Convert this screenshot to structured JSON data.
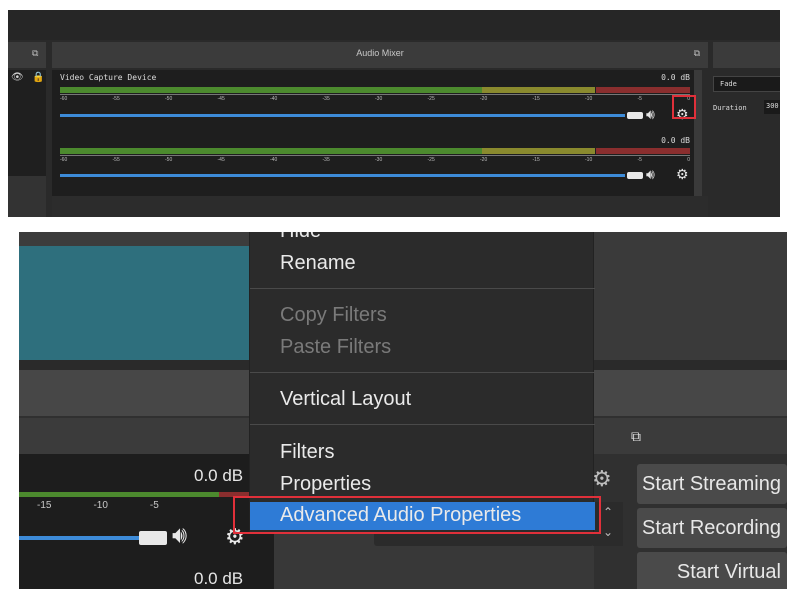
{
  "top_panel": {
    "mixer_title": "Audio Mixer",
    "source_name": "Video Capture Device",
    "db_level_1": "0.0 dB",
    "db_level_2": "0.0 dB",
    "ticks": [
      "-60",
      "-55",
      "-50",
      "-45",
      "-40",
      "-35",
      "-30",
      "-25",
      "-20",
      "-15",
      "-10",
      "-5",
      "0"
    ],
    "transition": {
      "type": "Fade",
      "duration_label": "Duration",
      "duration_value": "300"
    }
  },
  "bottom_panel": {
    "db_a": "0.0 dB",
    "db_b": "0.0 dB",
    "ticks": [
      "-15",
      "-10",
      "-5"
    ],
    "context_menu": {
      "items": [
        {
          "label": "Hide",
          "enabled": true
        },
        {
          "label": "Rename",
          "enabled": true
        },
        {
          "label": "Copy Filters",
          "enabled": false
        },
        {
          "label": "Paste Filters",
          "enabled": false
        },
        {
          "label": "Vertical Layout",
          "enabled": true
        },
        {
          "label": "Filters",
          "enabled": true
        },
        {
          "label": "Properties",
          "enabled": true
        },
        {
          "label": "Advanced Audio Properties",
          "enabled": true,
          "highlighted": true
        }
      ]
    },
    "controls": {
      "start_streaming": "Start Streaming",
      "start_recording": "Start Recording",
      "start_virtual_camera": "Start Virtual Camera"
    }
  },
  "colors": {
    "highlight": "#2e7bd6",
    "annotation_red": "#e0303a",
    "slider_blue": "#3d8bd8"
  }
}
